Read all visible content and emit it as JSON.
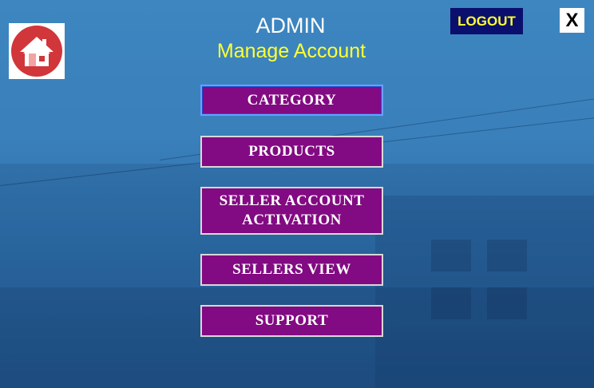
{
  "header": {
    "title": "ADMIN",
    "subtitle": "Manage Account",
    "logout_label": "LOGOUT",
    "close_label": "X"
  },
  "menu": [
    {
      "label": "CATEGORY"
    },
    {
      "label": "PRODUCTS"
    },
    {
      "label": "SELLER ACCOUNT ACTIVATION"
    },
    {
      "label": "SELLERS VIEW"
    },
    {
      "label": "SUPPORT"
    }
  ],
  "icons": {
    "home": "home-icon"
  },
  "colors": {
    "background": "#2f74ad",
    "menu_button": "#820a82",
    "subtitle": "#ffff33",
    "logout_bg": "#0a0f6e",
    "home_circle": "#d1363a"
  }
}
